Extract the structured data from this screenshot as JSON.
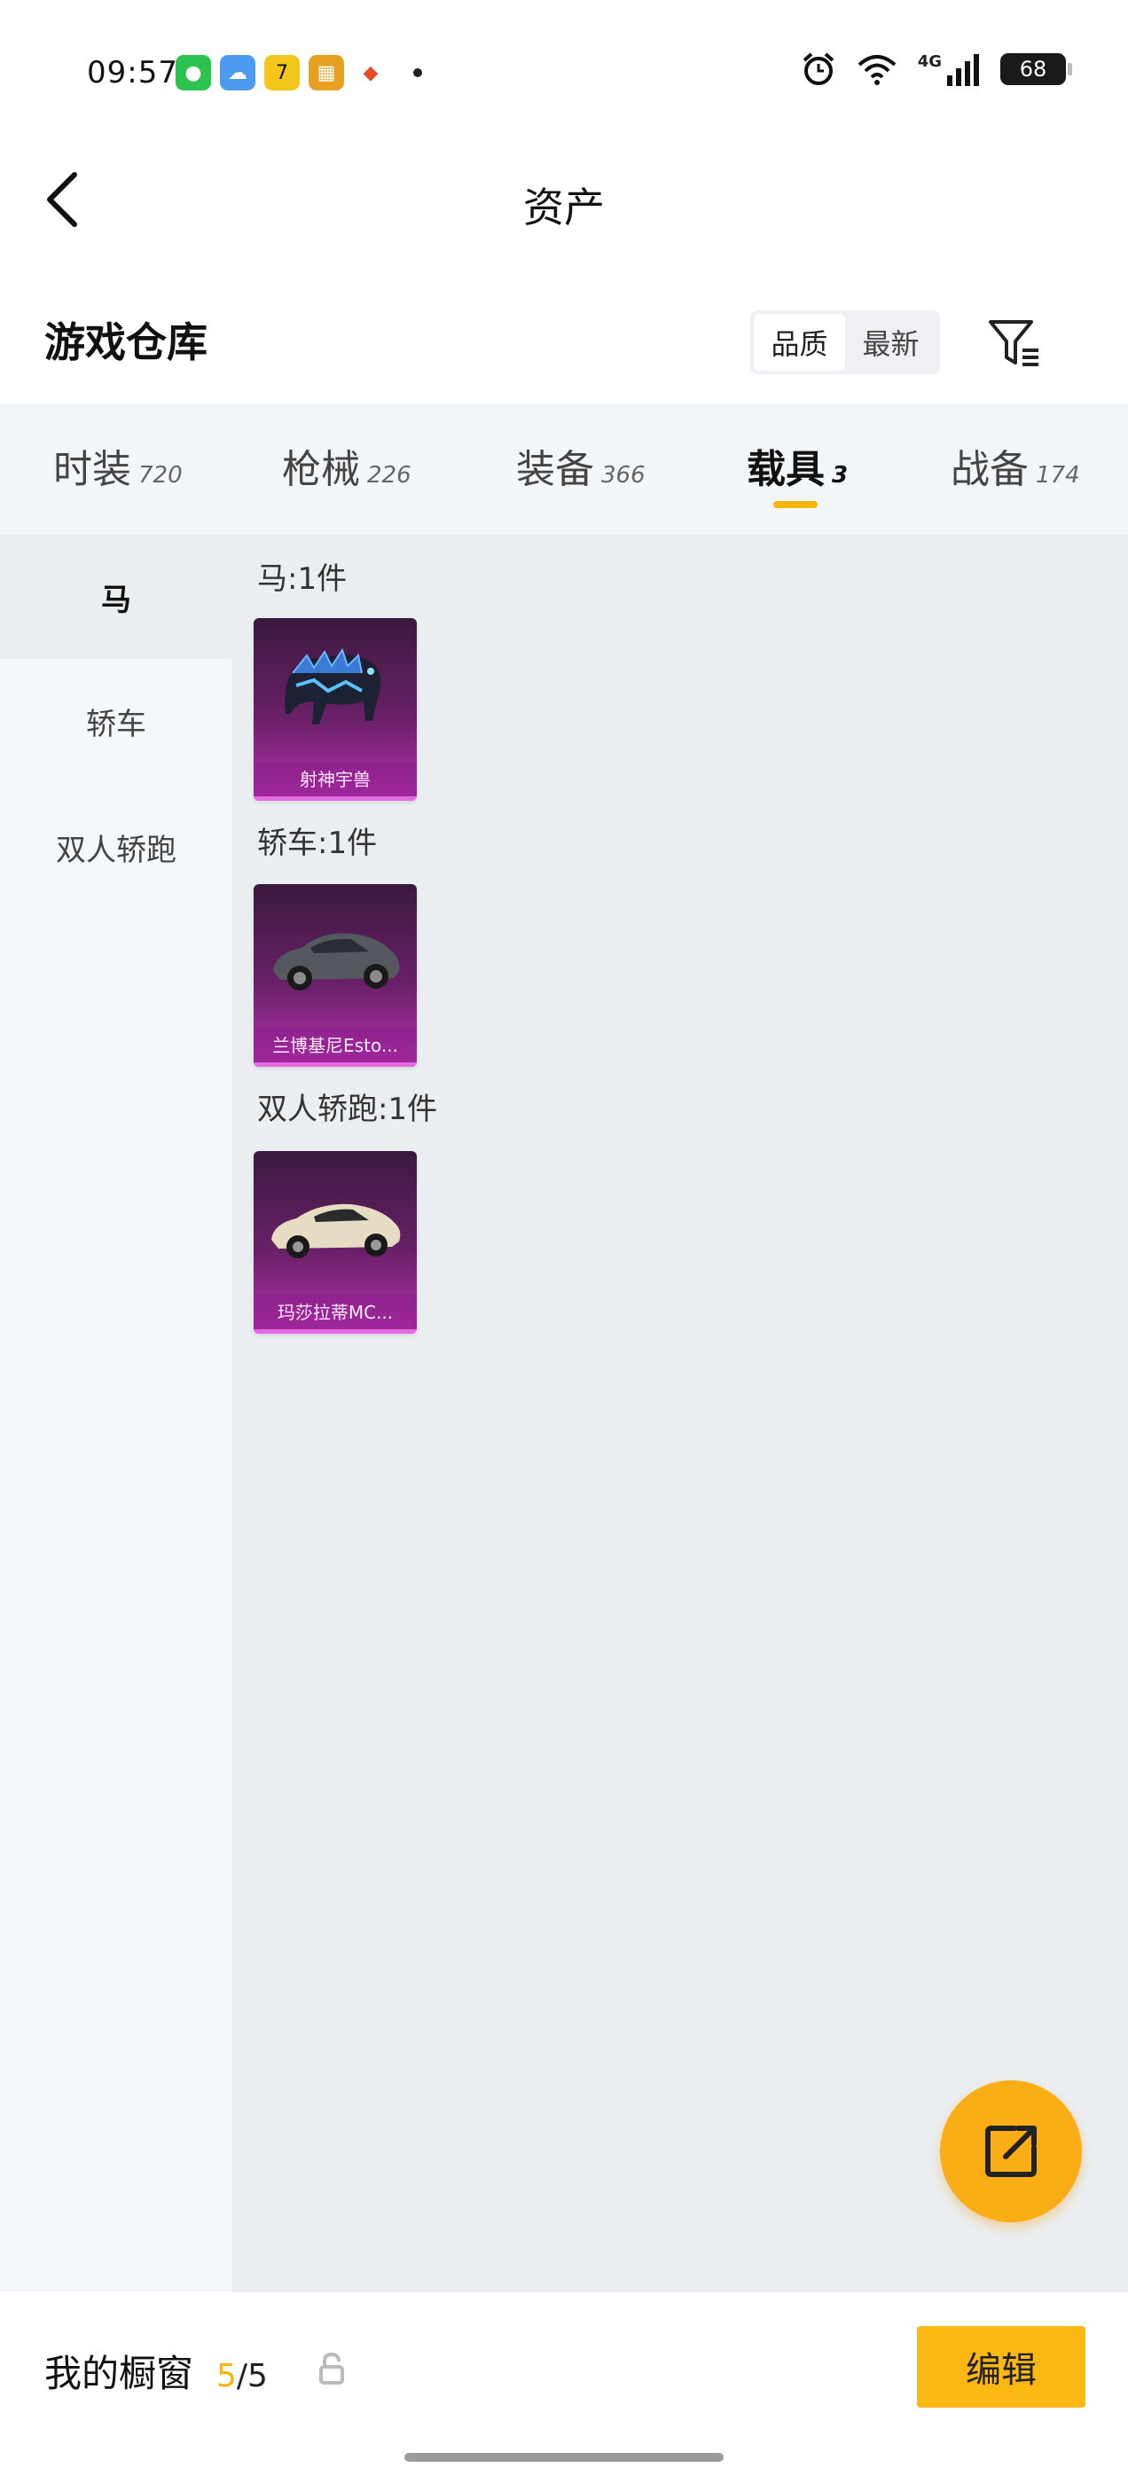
{
  "status_bar": {
    "time": "09:57",
    "battery": "68",
    "network": "4G"
  },
  "header": {
    "title": "资产"
  },
  "warehouse": {
    "title": "游戏仓库",
    "sort_options": [
      "品质",
      "最新"
    ],
    "sort_active": "品质"
  },
  "tabs": [
    {
      "label": "时装",
      "count": "720"
    },
    {
      "label": "枪械",
      "count": "226"
    },
    {
      "label": "装备",
      "count": "366"
    },
    {
      "label": "载具",
      "count": "3"
    },
    {
      "label": "战备",
      "count": "174"
    }
  ],
  "sidebar": {
    "items": [
      {
        "label": "马"
      },
      {
        "label": "轿车"
      },
      {
        "label": "双人轿跑"
      }
    ]
  },
  "sections": [
    {
      "label": "马:1件",
      "items": [
        {
          "name": "射神宇兽"
        }
      ]
    },
    {
      "label": "轿车:1件",
      "items": [
        {
          "name": "兰博基尼Esto..."
        }
      ]
    },
    {
      "label": "双人轿跑:1件",
      "items": [
        {
          "name": "玛莎拉蒂MC..."
        }
      ]
    }
  ],
  "bottom_bar": {
    "label": "我的橱窗",
    "count_current": "5",
    "count_total": "/5",
    "edit_label": "编辑"
  },
  "colors": {
    "accent": "#f5b50a",
    "card_bg": "#8a2a86",
    "fab": "#f9ae16"
  }
}
